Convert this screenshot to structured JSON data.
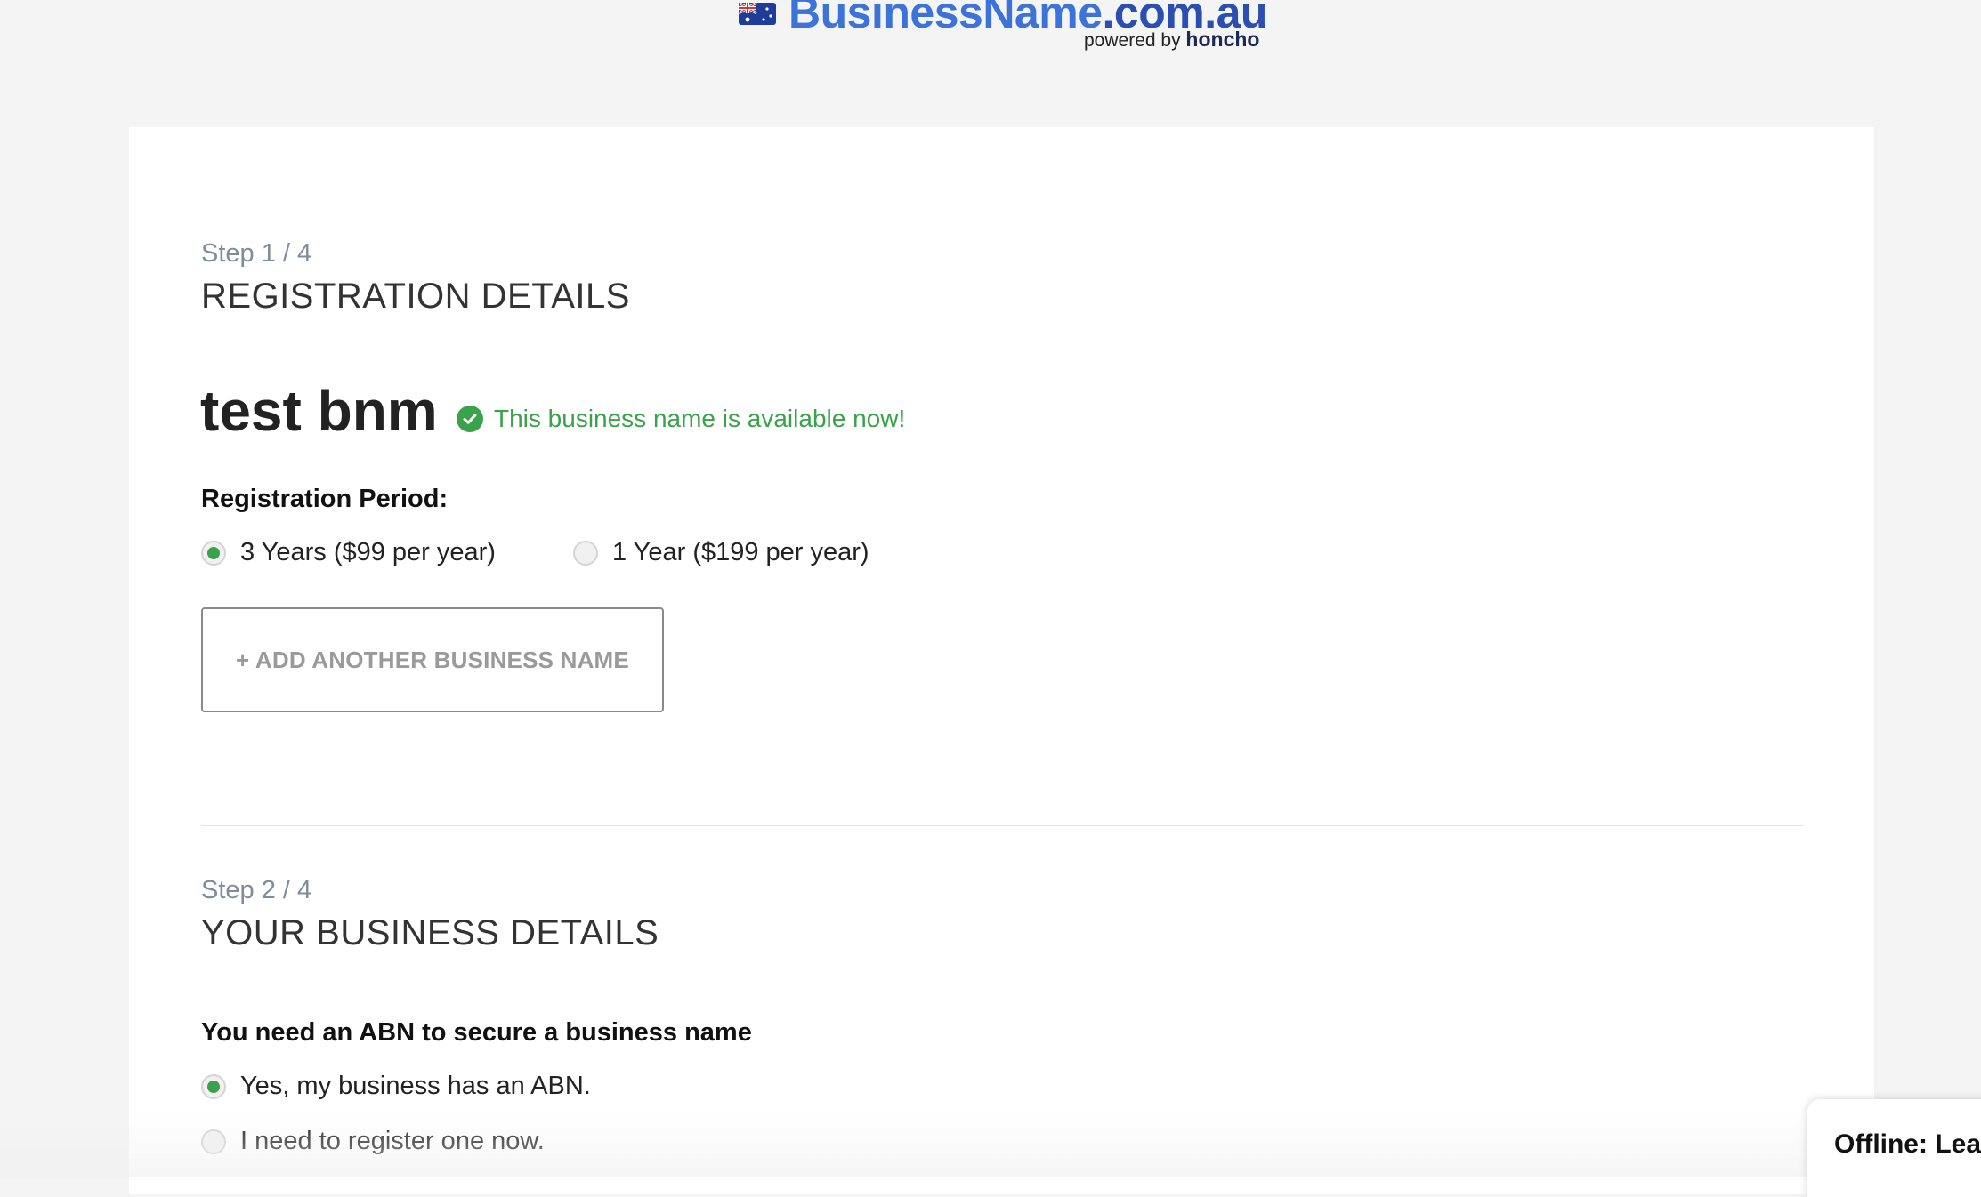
{
  "header": {
    "logo_main": "BusinessName",
    "logo_domain": ".com.au",
    "logo_powered_by": "powered by",
    "logo_brand": "honcho",
    "flag_icon": "australian-flag-icon"
  },
  "step1": {
    "step_label": "Step 1 / 4",
    "title": "REGISTRATION DETAILS",
    "business_name": "test bnm",
    "availability_text": "This business name is available now!",
    "period_label": "Registration Period:",
    "options": [
      {
        "label": "3 Years ($99 per year)",
        "selected": true
      },
      {
        "label": "1 Year ($199 per year)",
        "selected": false
      }
    ],
    "add_button_label": "+ ADD ANOTHER BUSINESS NAME"
  },
  "step2": {
    "step_label": "Step 2 / 4",
    "title": "YOUR BUSINESS DETAILS",
    "abn_label": "You need an ABN to secure a business name",
    "options": [
      {
        "label": "Yes, my business has an ABN.",
        "selected": true
      },
      {
        "label": "I need to register one now.",
        "selected": false
      }
    ]
  },
  "chat": {
    "label": "Offline: Lea"
  },
  "colors": {
    "accent_green": "#3aa24a",
    "logo_blue": "#3b73d9",
    "step_gray": "#7f8c99"
  }
}
